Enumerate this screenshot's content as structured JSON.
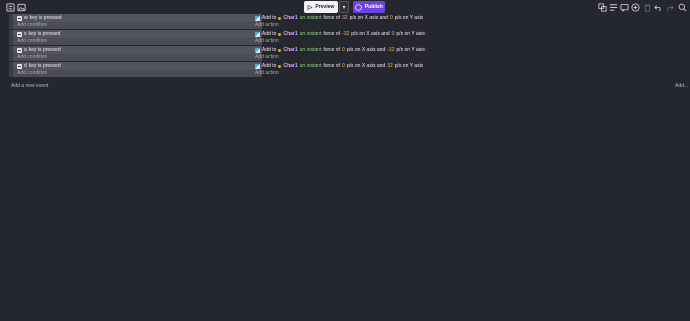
{
  "toolbar": {
    "left_icons": [
      "events-sheet-icon",
      "scene-icon"
    ],
    "preview_label": "Preview",
    "publish_label": "Publish",
    "right_icons": [
      "object-groups-icon",
      "layers-icon",
      "comment-icon",
      "add-event-icon",
      "delete-icon",
      "undo-icon",
      "redo-icon",
      "search-icon"
    ]
  },
  "events": [
    {
      "key": "w",
      "condition_text": "key is pressed",
      "add_condition": "Add condition",
      "action": {
        "prefix": "Add to",
        "object": "Char1",
        "force_text": "an instant",
        "middle": "force of",
        "x_value": "32",
        "x_text": "p/s on X axis and",
        "y_value": "0",
        "y_text": "p/s on Y axis"
      },
      "add_action": "Add action"
    },
    {
      "key": "s",
      "condition_text": "key is pressed",
      "add_condition": "Add condition",
      "action": {
        "prefix": "Add to",
        "object": "Char1",
        "force_text": "an instant",
        "middle": "force of",
        "x_value": "-32",
        "x_text": "p/s on X axis and",
        "y_value": "0",
        "y_text": "p/s on Y axis"
      },
      "add_action": "Add action"
    },
    {
      "key": "a",
      "condition_text": "key is pressed",
      "add_condition": "Add condition",
      "action": {
        "prefix": "Add to",
        "object": "Char1",
        "force_text": "an instant",
        "middle": "force of",
        "x_value": "0",
        "x_text": "p/s on X axis and",
        "y_value": "-32",
        "y_text": "p/s on Y axis"
      },
      "add_action": "Add action"
    },
    {
      "key": "d",
      "condition_text": "key is pressed",
      "add_condition": "Add condition",
      "action": {
        "prefix": "Add to",
        "object": "Char1",
        "force_text": "an instant",
        "middle": "force of",
        "x_value": "0",
        "x_text": "p/s on X axis and",
        "y_value": "32",
        "y_text": "p/s on Y axis"
      },
      "add_action": "Add action"
    }
  ],
  "footer": {
    "add_event": "Add a new event",
    "add_more": "Add..."
  },
  "colors": {
    "background": "#25272e",
    "condition_panel": "#4a4c57",
    "publish": "#6b44e3",
    "object_name": "#d9a6ff",
    "parameter": "#8fd27a",
    "number": "#f0b060"
  }
}
